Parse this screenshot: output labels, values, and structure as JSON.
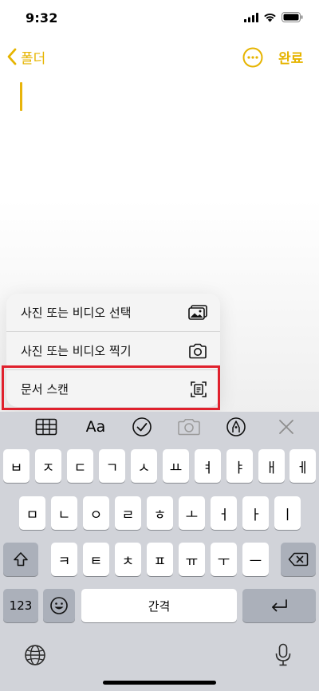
{
  "status_bar": {
    "time": "9:32",
    "accent": "#000000"
  },
  "nav": {
    "back_label": "폴더",
    "done_label": "완료",
    "accent": "#e6b400",
    "more_icon": "ellipsis-circle-icon"
  },
  "attach_menu": {
    "items": [
      {
        "label": "사진 또는 비디오 선택",
        "icon": "photo-icon"
      },
      {
        "label": "사진 또는 비디오 찍기",
        "icon": "camera-icon"
      },
      {
        "label": "문서 스캔",
        "icon": "document-scan-icon"
      }
    ],
    "highlight_color": "#e0212d"
  },
  "keyboard": {
    "toolbar": {
      "table_icon": "table-icon",
      "format_label": "Aa",
      "checklist_icon": "checkmark-circle-icon",
      "camera_icon": "camera-icon",
      "markup_icon": "pen-circle-icon",
      "close_icon": "close-icon"
    },
    "row1": [
      "ㅂ",
      "ㅈ",
      "ㄷ",
      "ㄱ",
      "ㅅ",
      "ㅛ",
      "ㅕ",
      "ㅑ",
      "ㅐ",
      "ㅔ"
    ],
    "row2": [
      "ㅁ",
      "ㄴ",
      "ㅇ",
      "ㄹ",
      "ㅎ",
      "ㅗ",
      "ㅓ",
      "ㅏ",
      "ㅣ"
    ],
    "row3": [
      "ㅋ",
      "ㅌ",
      "ㅊ",
      "ㅍ",
      "ㅠ",
      "ㅜ",
      "ㅡ"
    ],
    "numbers_label": "123",
    "space_label": "간격"
  }
}
